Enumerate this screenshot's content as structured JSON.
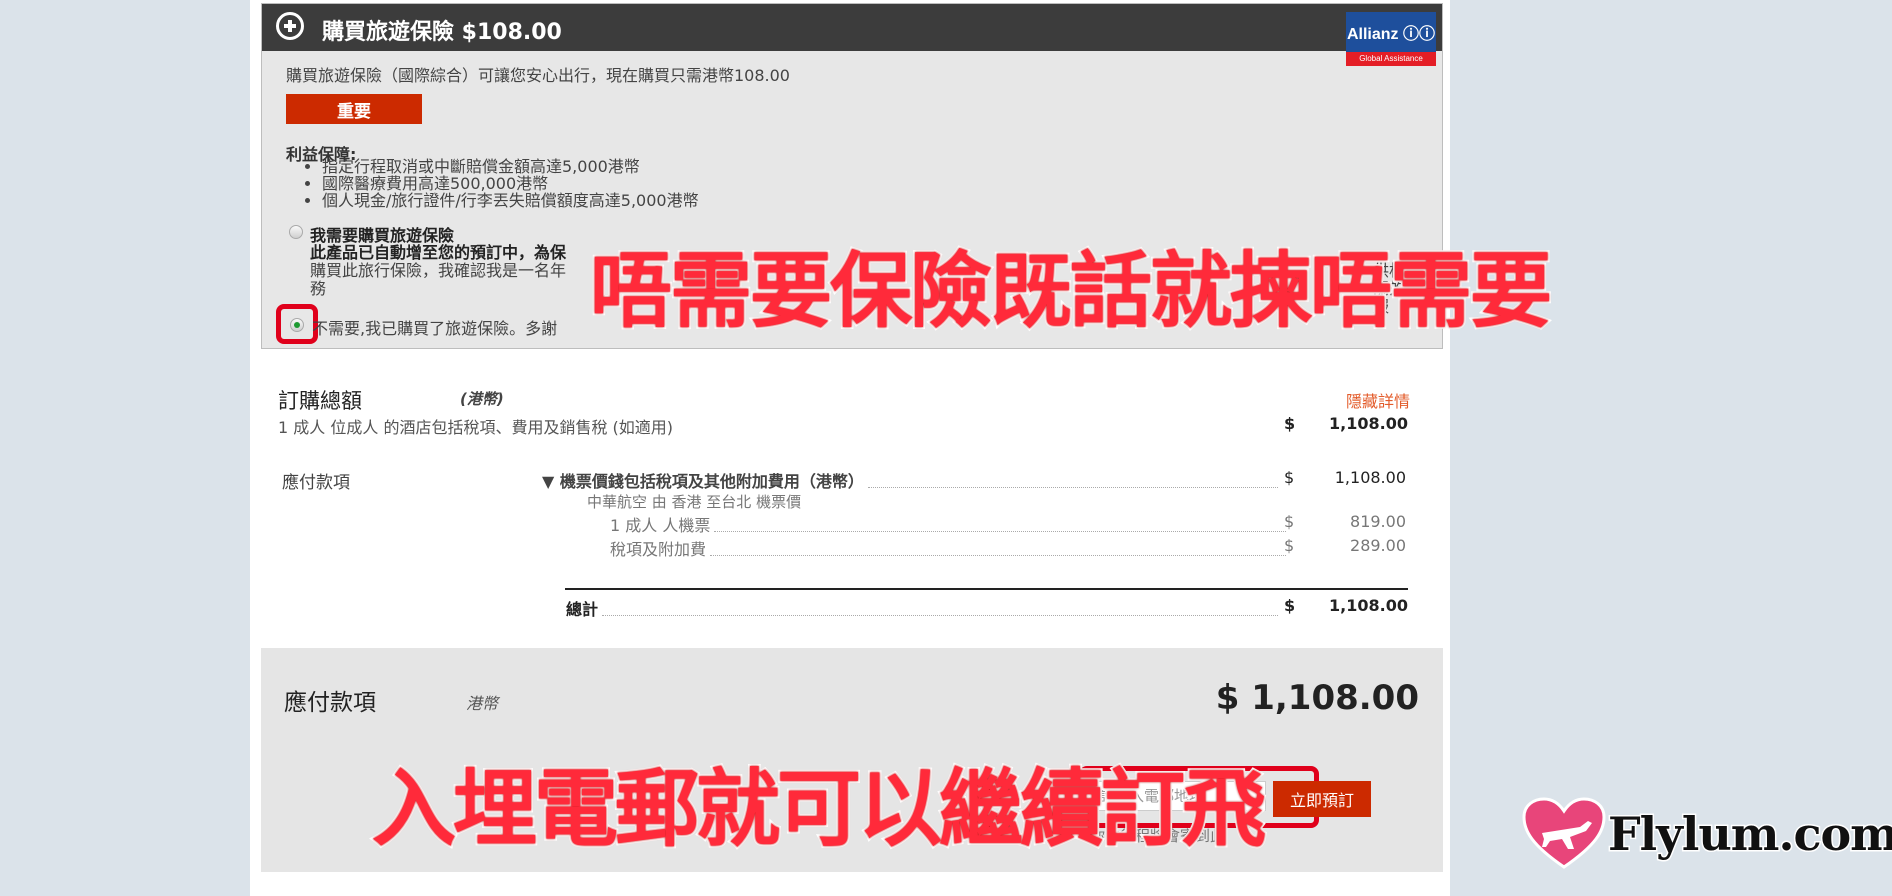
{
  "insurance": {
    "title": "購買旅遊保險 $108.00",
    "description": "購買旅遊保險（國際綜合）可讓您安心出行，現在購買只需港幣108.00",
    "important_button": "重要",
    "benefits_heading": "利益保障:",
    "benefits": [
      "指定行程取消或中斷賠償金額高達5,000港幣",
      "國際醫療費用高達500,000港幣",
      "個人現金/旅行證件/行李丟失賠償額度高達5,000港幣"
    ],
    "option_yes_label": "我需要購買旅遊保險",
    "option_yes_note_bold": "此產品已自動增至您的預訂中，為保",
    "option_yes_note_tail": "購買此旅行保險，我確認我是一名年",
    "option_yes_note_right": "供相關的服",
    "option_yes_note_end": "務",
    "option_no_label": "不需要,我已購買了旅遊保險。多謝",
    "logo": {
      "brand": "Allianz ⓘⓘ",
      "sub": "Global Assistance",
      "brand_color": "#1e4f9c",
      "accent_color": "#e41e26"
    }
  },
  "order_total": {
    "title": "訂購總額",
    "currency": "(港幣)",
    "hide_details": "隱藏詳情",
    "description": "1 成人 位成人 的酒店包括稅項、費用及銷售稅 (如適用)",
    "dollar": "$",
    "amount": "1,108.00"
  },
  "payable": {
    "label": "應付款項",
    "rows": [
      {
        "label": "▼ 機票價錢包括稅項及其他附加費用（港幣）",
        "dollar": "$",
        "amount": "1,108.00"
      },
      {
        "label": "1 成人 人機票",
        "dollar": "$",
        "amount": "819.00"
      },
      {
        "label": "稅項及附加費",
        "dollar": "$",
        "amount": "289.00"
      },
      {
        "label": "總計",
        "dollar": "$",
        "amount": "1,108.00"
      }
    ],
    "airline_line": "中華航空 由 香港 至台北 機票價"
  },
  "payment": {
    "title": "應付款項",
    "currency": "港幣",
    "amount": "$ 1,108.00",
    "email_placeholder": "請輸入電郵地址",
    "book_button": "立即預訂",
    "itinerary_note": "你的行程將會寄到此"
  },
  "captions": {
    "top": "唔需要保險既話就揀唔需要",
    "bottom": "入埋電郵就可以繼續訂飛"
  },
  "watermark": {
    "text": "Flylum.com",
    "heart_color": "#e8457a"
  },
  "colors": {
    "accent_red": "#cc2a00",
    "highlight": "#e0001b",
    "link": "#e35b2a"
  }
}
